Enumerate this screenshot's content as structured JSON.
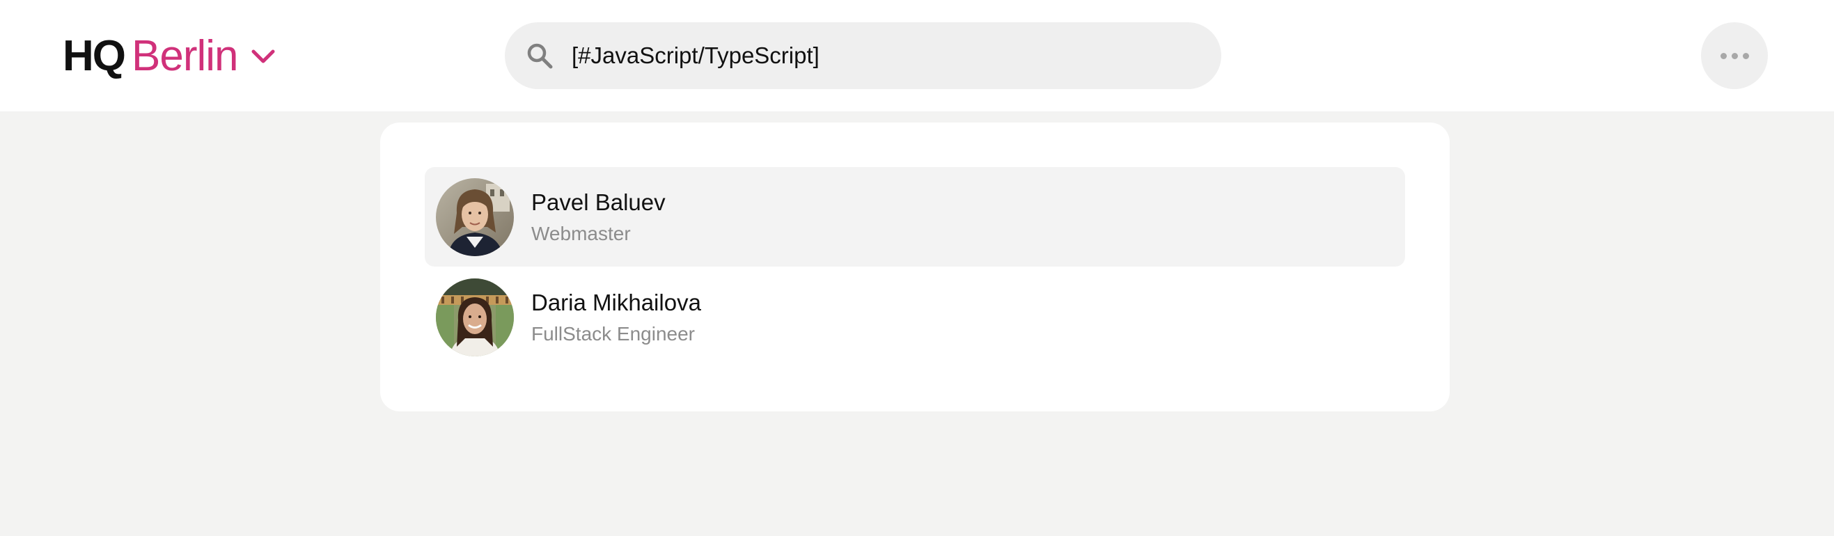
{
  "header": {
    "logo": {
      "prefix": "HQ",
      "city": "Berlin",
      "brand_color": "#d0317a",
      "chevron_icon": "chevron-down-icon"
    },
    "search": {
      "icon": "search-icon",
      "value": "[#JavaScript/TypeScript]"
    },
    "more_menu_icon": "more-horizontal-icon"
  },
  "results": [
    {
      "name": "Pavel Baluev",
      "title": "Webmaster",
      "highlighted": true
    },
    {
      "name": "Daria Mikhailova",
      "title": "FullStack Engineer",
      "highlighted": false
    }
  ]
}
